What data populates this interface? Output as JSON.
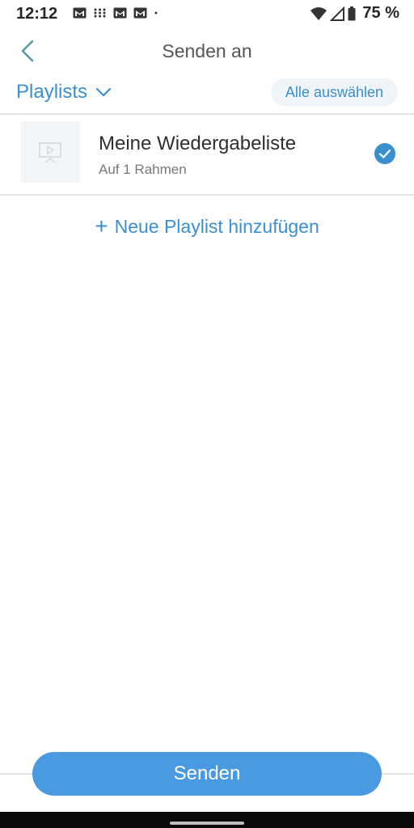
{
  "status_bar": {
    "time": "12:12",
    "battery": "75 %",
    "icons": [
      "gmail-icon",
      "grid-icon",
      "gmail-icon",
      "gmail-icon",
      "dot-icon"
    ],
    "right_icons": [
      "wifi-icon",
      "signal-icon",
      "battery-icon"
    ]
  },
  "header": {
    "title": "Senden an",
    "back_icon": "chevron-left-icon"
  },
  "filter": {
    "dropdown_label": "Playlists",
    "select_all_label": "Alle auswählen"
  },
  "playlists": [
    {
      "title": "Meine Wiedergabeliste",
      "subtitle": "Auf 1 Rahmen",
      "selected": true
    }
  ],
  "add_playlist": {
    "plus": "+",
    "label": "Neue Playlist hinzufügen"
  },
  "footer": {
    "send_label": "Senden"
  },
  "colors": {
    "accent": "#3a8fcf",
    "button": "#4a9ae1",
    "divider": "#e3e3e3"
  }
}
